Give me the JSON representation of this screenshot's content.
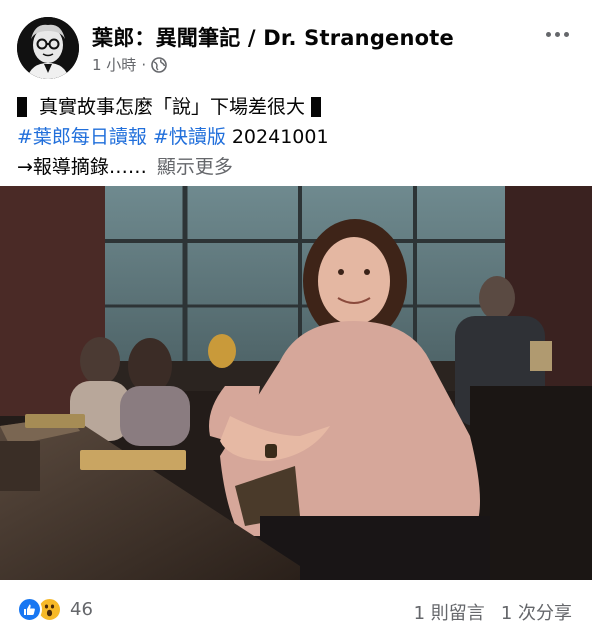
{
  "post": {
    "page_name": "葉郎：異聞筆記 / Dr. Strangenote",
    "timestamp": "1 小時",
    "separator": "·",
    "privacy_icon": "globe-icon",
    "more_icon": "more-dots-icon",
    "title": "真實故事怎麼「說」下場差很大",
    "hashtag_1": "#葉郎每日讀報",
    "hashtag_2": "#快讀版",
    "date_text": "20241001",
    "excerpt": "→報導摘錄……",
    "see_more": "顯示更多"
  },
  "footer": {
    "reaction_icons": [
      "like-icon",
      "wow-icon"
    ],
    "reaction_count": "46",
    "comments": "1 則留言",
    "shares": "1 次分享"
  },
  "colors": {
    "hashtag": "#216fdb",
    "secondary_text": "#65676b",
    "like_blue": "#1877f2",
    "wow_yellow": "#f7b928"
  }
}
